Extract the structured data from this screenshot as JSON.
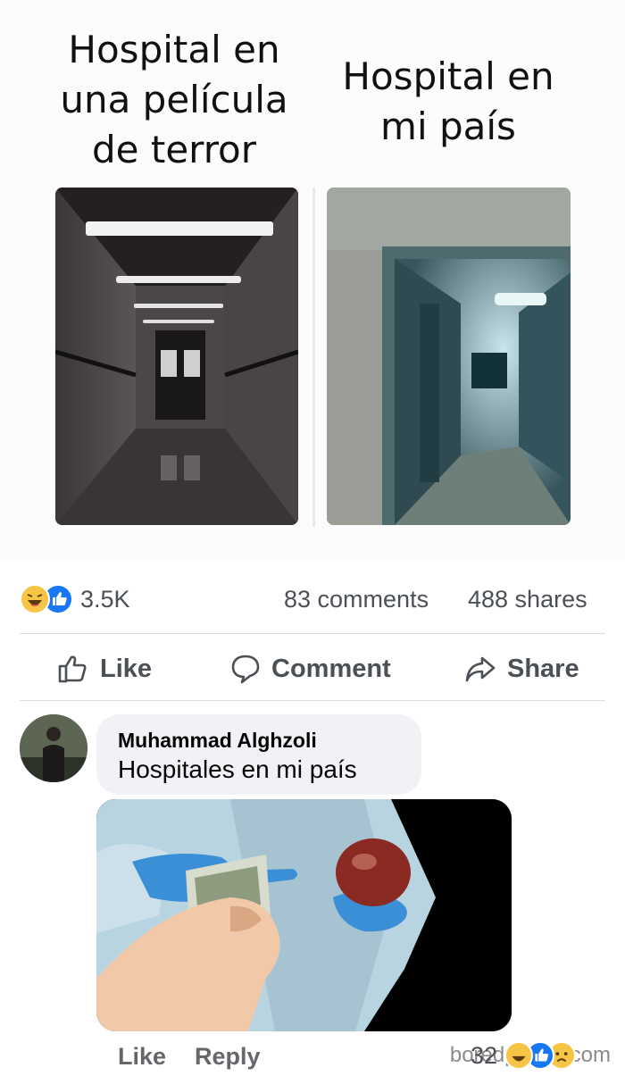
{
  "meme": {
    "left_caption": "Hospital en\nuna película\nde terror",
    "right_caption": "Hospital en\nmi país"
  },
  "post_stats": {
    "reactions_count": "3.5K",
    "comments": "83 comments",
    "shares": "488 shares"
  },
  "post_actions": {
    "like": "Like",
    "comment": "Comment",
    "share": "Share"
  },
  "comment": {
    "author": "Muhammad Alghzoli",
    "text": "Hospitales en mi país",
    "like": "Like",
    "reply": "Reply",
    "reactions_count": "32"
  },
  "watermark": "boredpanda.com",
  "colors": {
    "like_blue": "#1877f2",
    "haha_yellow": "#f7c545",
    "text_gray": "#4b4f56"
  },
  "icons": [
    "haha-reaction-icon",
    "like-reaction-icon",
    "sad-reaction-icon",
    "thumbs-up-icon",
    "speech-bubble-icon",
    "share-arrow-icon"
  ]
}
